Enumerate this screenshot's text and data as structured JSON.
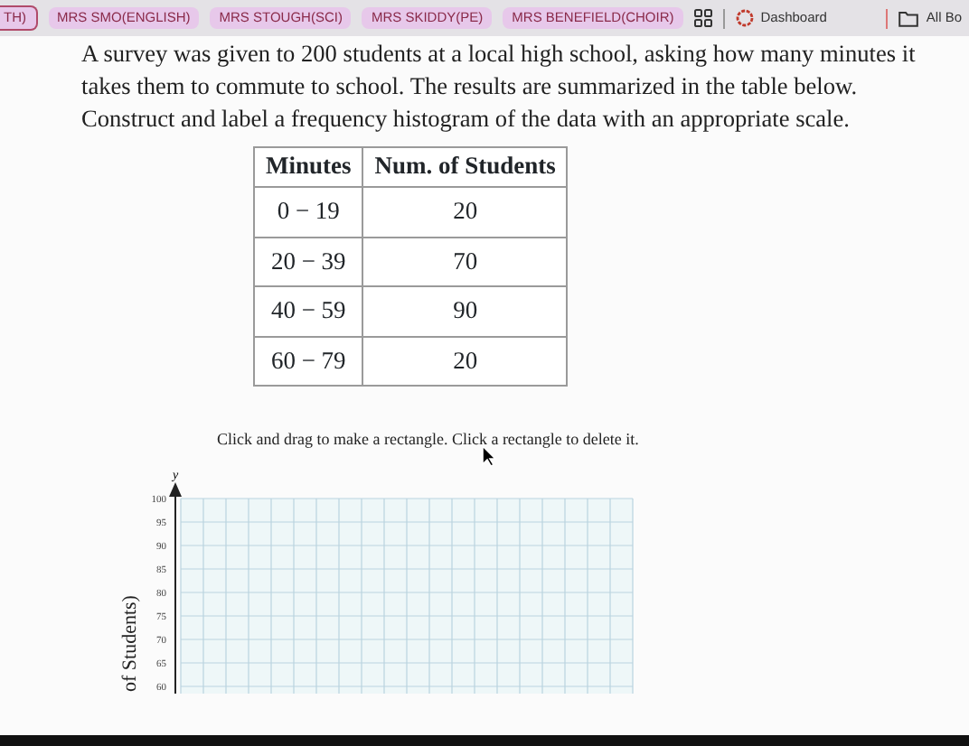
{
  "bookmarks": [
    {
      "label": "TH)"
    },
    {
      "label": "MRS SMO(ENGLISH)"
    },
    {
      "label": "MRS STOUGH(SCI)"
    },
    {
      "label": "MRS SKIDDY(PE)"
    },
    {
      "label": "MRS BENEFIELD(CHOIR)"
    }
  ],
  "bookmark_links": [
    {
      "kind": "dashboard",
      "label": "Dashboard"
    },
    {
      "kind": "folder",
      "label": "All Bo"
    }
  ],
  "problem_lines": [
    "A survey was given to 200 students at a local high school, asking how many minutes it",
    "takes them to commute to school. The results are summarized in the table below.",
    "Construct and label a frequency histogram of the data with an appropriate scale."
  ],
  "table": {
    "columns": [
      "Minutes",
      "Num. of Students"
    ],
    "rows": [
      [
        "0 − 19",
        "20"
      ],
      [
        "20 − 39",
        "70"
      ],
      [
        "40 − 59",
        "90"
      ],
      [
        "60 − 79",
        "20"
      ]
    ]
  },
  "instruction": "Click and drag to make a rectangle. Click a rectangle to delete it.",
  "graph": {
    "axis_letter": "y",
    "y_title": "of Students)",
    "yticks": [
      "100",
      "95",
      "90",
      "85",
      "80",
      "75",
      "70",
      "65",
      "60"
    ]
  }
}
